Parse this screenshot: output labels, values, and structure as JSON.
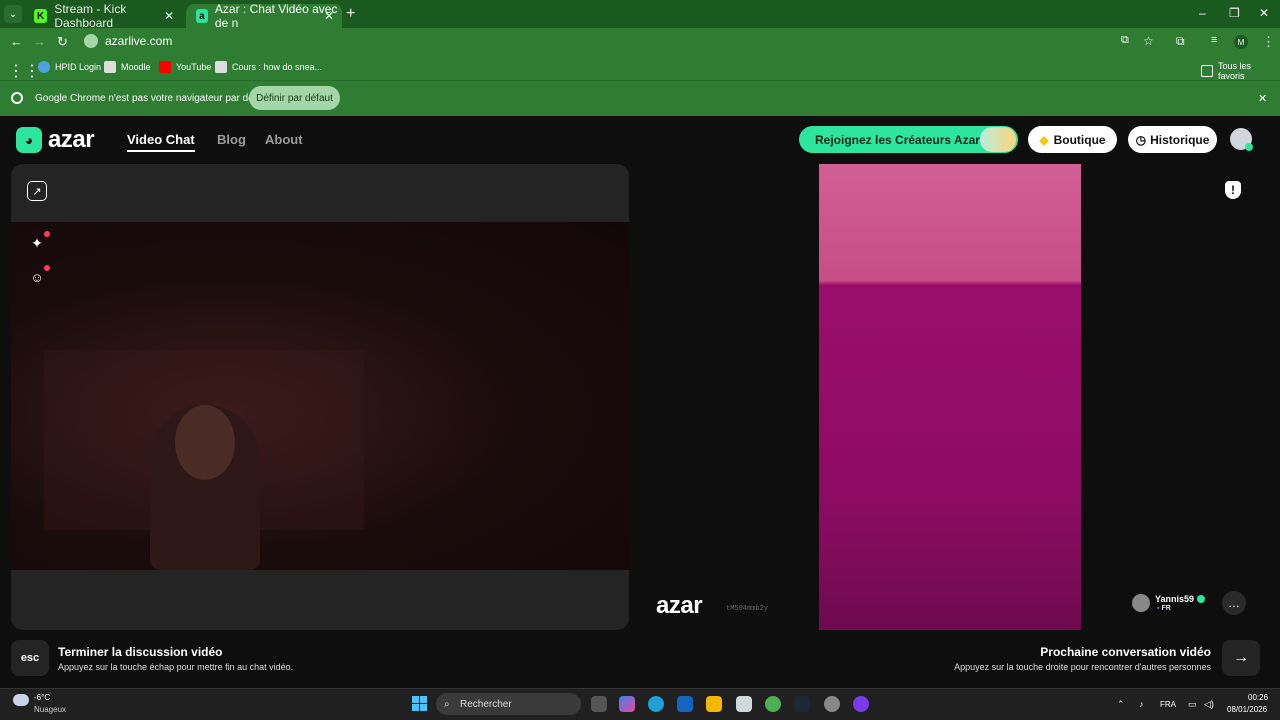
{
  "browser": {
    "tabs": [
      {
        "label": "Stream - Kick Dashboard",
        "favicon_color": "#53fc18"
      },
      {
        "label": "Azar : Chat Vidéo avec de n",
        "favicon_color": "#2ee59d"
      }
    ],
    "url": "azarlive.com",
    "profile_initial": "M",
    "bookmarks": [
      {
        "label": "HPID Login",
        "icon": "globe-icon"
      },
      {
        "label": "Moodle",
        "icon": "page-icon"
      },
      {
        "label": "YouTube",
        "icon": "youtube-icon"
      },
      {
        "label": "Cours : how do snea...",
        "icon": "page-icon"
      }
    ],
    "all_bookmarks": "Tous les favoris",
    "infobar": {
      "text": "Google Chrome n'est pas votre navigateur par défaut",
      "button": "Définir par défaut"
    }
  },
  "site": {
    "logo": "azar",
    "nav": [
      "Video Chat",
      "Blog",
      "About"
    ],
    "buttons": {
      "creators": "Rejoignez les Créateurs Azar",
      "boutique": "Boutique",
      "history": "Historique"
    },
    "watermark": "azar",
    "watermark_id": "tM504mmb2y",
    "peer": {
      "name": "Yannis59",
      "country": "FR"
    },
    "footer": {
      "esc_key": "esc",
      "end_title": "Terminer la discussion vidéo",
      "end_desc": "Appuyez sur la touche échap pour mettre fin au chat vidéo.",
      "next_title": "Prochaine conversation vidéo",
      "next_desc": "Appuyez sur la touche droite pour rencontrer d'autres personnes"
    },
    "accent": "#2ee59d"
  },
  "taskbar": {
    "weather_temp": "-6°C",
    "weather_desc": "Nuageux",
    "search_placeholder": "Rechercher",
    "lang": "FRA",
    "time": "00:26",
    "date": "08/01/2026"
  }
}
